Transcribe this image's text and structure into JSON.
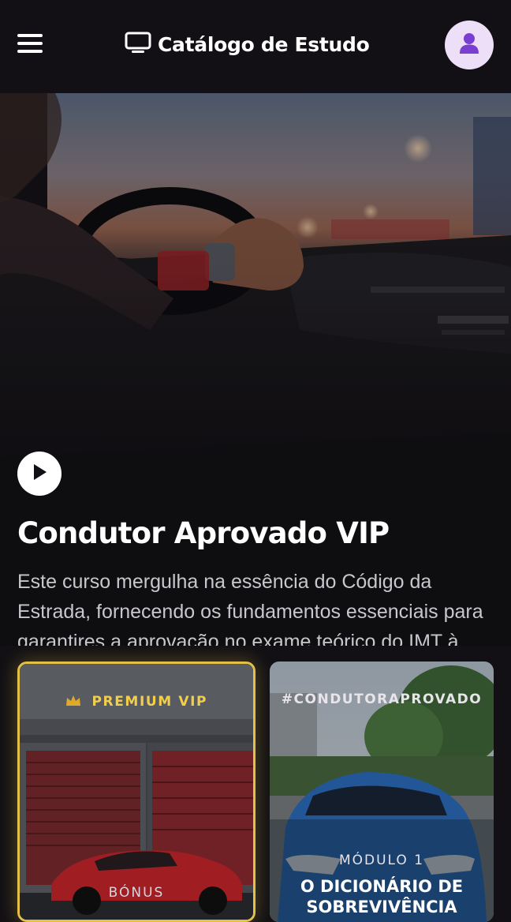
{
  "header": {
    "title": "Catálogo de Estudo",
    "menu_icon": "hamburger-menu-icon",
    "brand_icon": "tv-icon",
    "avatar_icon": "user-icon",
    "avatar_bg": "#ecdff7",
    "avatar_fg": "#7a3fd1"
  },
  "hero": {
    "title": "Condutor Aprovado VIP",
    "description": "Este curso mergulha na essência do Código da Estrada, fornecendo os fundamentos essenciais para garantires a aprovação no exame teórico do IMT à primeira tentativa.",
    "play_icon": "play-icon"
  },
  "cards": [
    {
      "badge": "PREMIUM VIP",
      "badge_icon": "crown-icon",
      "label": "BÓNUS",
      "accent": "#e3c04a"
    },
    {
      "badge": "#CONDUTORAPROVADO",
      "label": "MÓDULO 1",
      "title": "O DICIONÁRIO DE SOBREVIVÊNCIA"
    }
  ]
}
